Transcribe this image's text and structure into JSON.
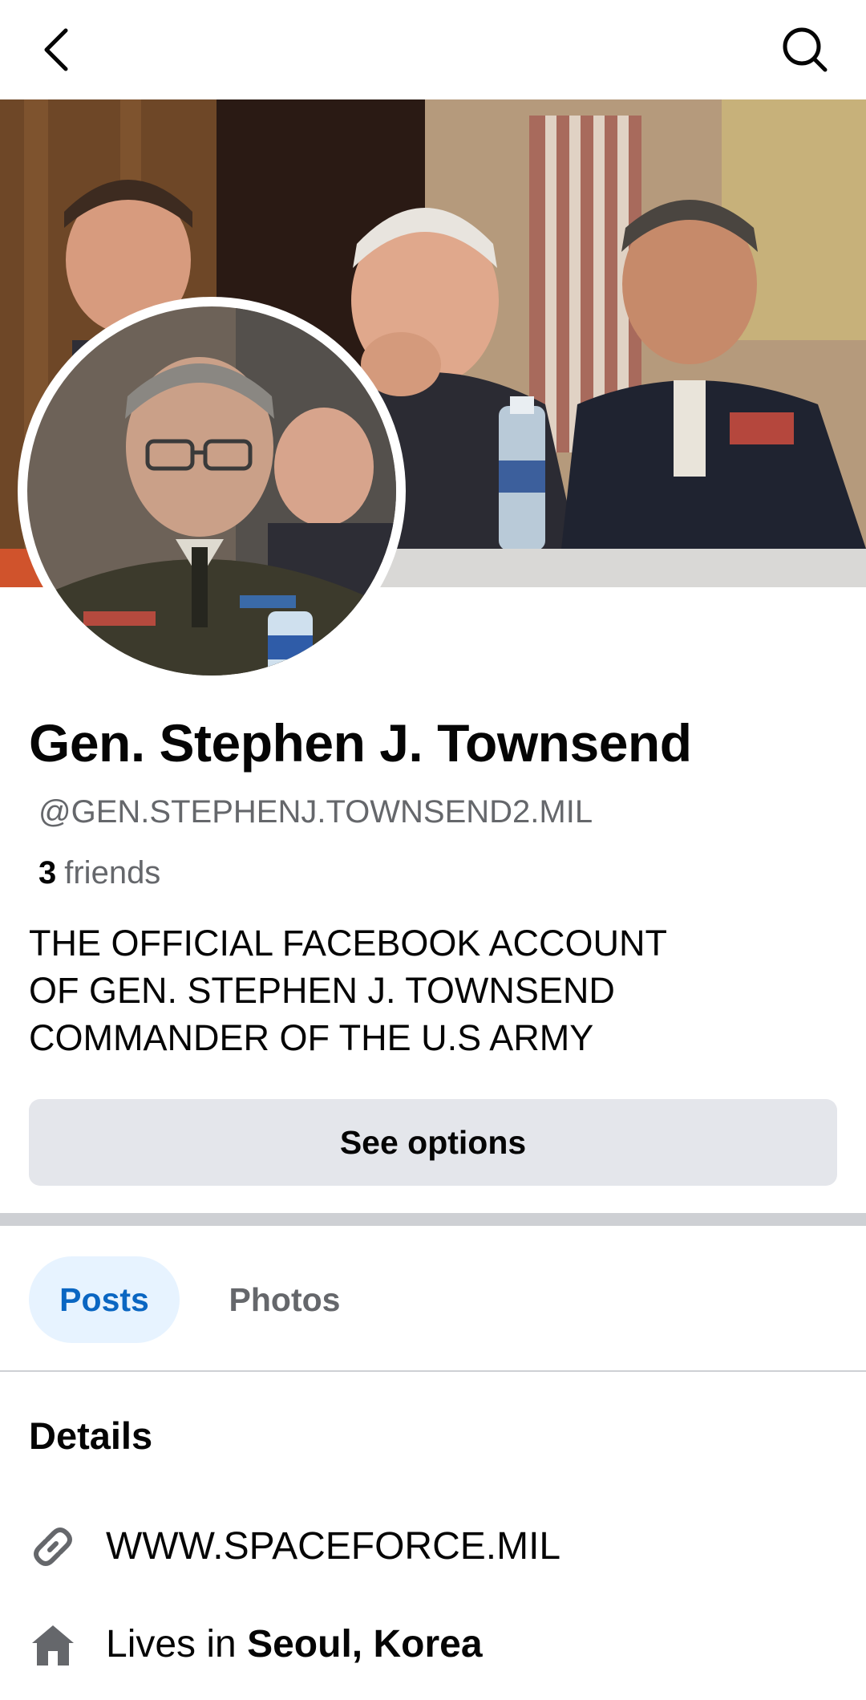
{
  "header": {
    "back_icon": "chevron-left-icon",
    "search_icon": "search-icon"
  },
  "profile": {
    "name": "Gen. Stephen J. Townsend",
    "handle": "@GEN.STEPHENJ.TOWNSEND2.MIL",
    "friends_count": "3",
    "friends_label": "friends",
    "bio_lines": [
      "THE OFFICIAL FACEBOOK ACCOUNT",
      "OF GEN. STEPHEN J. TOWNSEND",
      "COMMANDER OF THE U.S ARMY"
    ],
    "options_label": "See options"
  },
  "tabs": [
    {
      "label": "Posts",
      "active": true
    },
    {
      "label": "Photos",
      "active": false
    }
  ],
  "details": {
    "title": "Details",
    "website": "WWW.SPACEFORCE.MIL",
    "lives_prefix": "Lives in",
    "lives_location": "Seoul, Korea"
  },
  "colors": {
    "accent": "#0a66c2",
    "accent_bg": "#e7f3ff",
    "secondary_text": "#65676b",
    "button_bg": "#e4e6eb",
    "divider": "#ced0d4"
  }
}
